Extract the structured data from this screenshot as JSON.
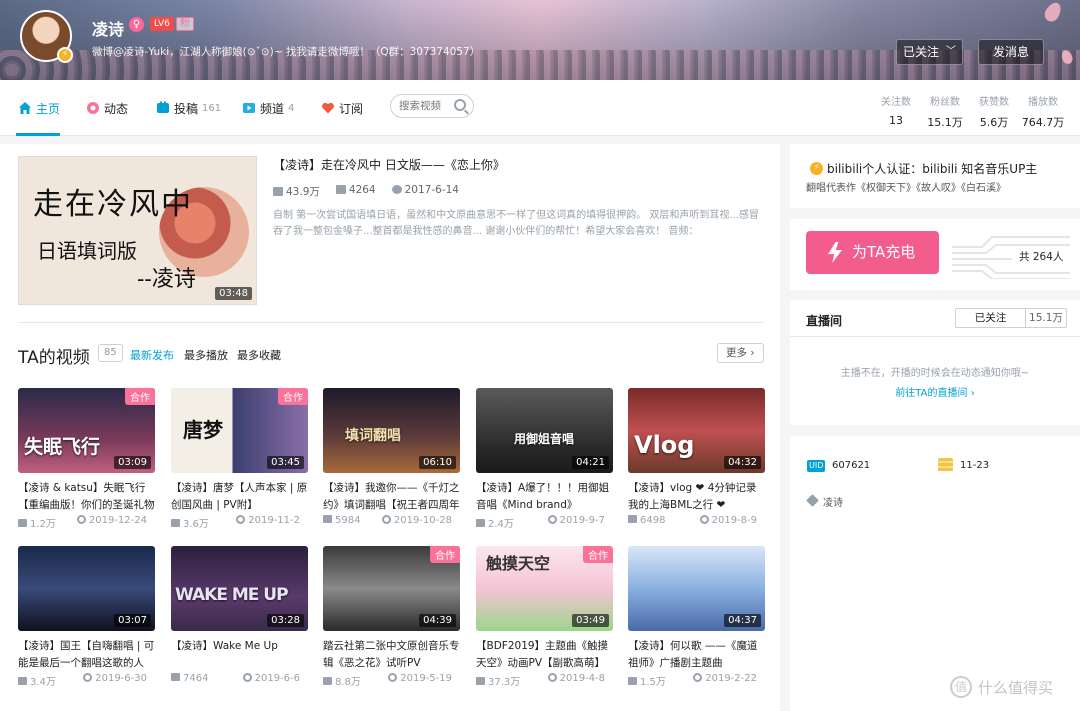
{
  "header": {
    "username": "凌诗",
    "gender_icon": "female-icon",
    "level": "LV6",
    "fan_badge": "粉",
    "sign": "微博@凌诗-Yuki，江湖人称御娘(⊙ˇ⊙)~ 找我请走微博哦！（Q群：307374057）",
    "followed_label": "已关注",
    "message_label": "发消息"
  },
  "nav": {
    "items": [
      {
        "label": "主页",
        "count": "",
        "icon": "home-icon"
      },
      {
        "label": "动态",
        "count": "",
        "icon": "dynamic-icon"
      },
      {
        "label": "投稿",
        "count": "161",
        "icon": "upload-icon"
      },
      {
        "label": "频道",
        "count": "4",
        "icon": "channel-icon"
      },
      {
        "label": "订阅",
        "count": "",
        "icon": "heart-icon"
      }
    ],
    "search_placeholder": "搜索视频",
    "stats": [
      {
        "label": "关注数",
        "value": "13"
      },
      {
        "label": "粉丝数",
        "value": "15.1万"
      },
      {
        "label": "获赞数",
        "value": "5.6万"
      },
      {
        "label": "播放数",
        "value": "764.7万"
      }
    ]
  },
  "featured": {
    "thumb_line1": "走在冷风中",
    "thumb_line2": "日语填词版",
    "thumb_line3": "--凌诗",
    "duration": "03:48",
    "title": "【凌诗】走在冷风中 日文版——《恋上你》",
    "plays": "43.9万",
    "danmaku": "4264",
    "date": "2017-6-14",
    "desc": "自制 第一次尝试国语填日语，虽然和中文原曲意思不一样了但这词真的填得很押韵。 双层和声听到耳视...感冒吞了我一整包金嗓子...整首都是我性感的鼻音... 谢谢小伙伴们的帮忙！希望大家会喜欢！ 音频："
  },
  "videos_section": {
    "title": "TA的视频",
    "count": "85",
    "sort_tabs": [
      "最新发布",
      "最多播放",
      "最多收藏"
    ],
    "more_label": "更多"
  },
  "videos": [
    {
      "thumb_text": "失眠飞行",
      "tag": "合作",
      "duration": "03:09",
      "title": "【凌诗 & katsu】失眠飞行【重编曲版！你们的圣诞礼物",
      "plays": "1.2万",
      "date": "2019-12-24"
    },
    {
      "thumb_text": "唐梦",
      "tag": "合作",
      "duration": "03:45",
      "title": "【凌诗】唐梦【人声本家 | 原创国风曲 | PV附】",
      "plays": "3.6万",
      "date": "2019-11-2"
    },
    {
      "thumb_text": "填词翻唱",
      "tag": "",
      "duration": "06:10",
      "title": "【凌诗】我邀你——《千灯之约》填词翻唱【祝王者四周年",
      "plays": "5984",
      "date": "2019-10-28"
    },
    {
      "thumb_text": "用御姐音唱",
      "tag": "",
      "duration": "04:21",
      "title": "【凌诗】A爆了！！！用御姐音唱《Mind brand》",
      "plays": "2.4万",
      "date": "2019-9-7"
    },
    {
      "thumb_text": "Vlog",
      "tag": "",
      "duration": "04:32",
      "title": "【凌诗】vlog ❤ 4分钟记录我的上海BML之行 ❤",
      "plays": "6498",
      "date": "2019-8-9"
    },
    {
      "thumb_text": "",
      "tag": "",
      "duration": "03:07",
      "title": "【凌诗】国王【自嗨翻唱 | 可能是最后一个翻唱这歌的人",
      "plays": "3.4万",
      "date": "2019-6-30"
    },
    {
      "thumb_text": "WAKE ME UP",
      "tag": "",
      "duration": "03:28",
      "title": "【凌诗】Wake Me Up",
      "plays": "7464",
      "date": "2019-6-6"
    },
    {
      "thumb_text": "",
      "tag": "合作",
      "duration": "04:39",
      "title": "踏云社第二张中文原创音乐专辑《恶之花》试听PV",
      "plays": "8.8万",
      "date": "2019-5-19"
    },
    {
      "thumb_text": "触摸天空",
      "tag": "合作",
      "duration": "03:49",
      "title": "【BDF2019】主题曲《触摸天空》动画PV【副歌高萌】",
      "plays": "37.3万",
      "date": "2019-4-8"
    },
    {
      "thumb_text": "",
      "tag": "",
      "duration": "04:37",
      "title": "【凌诗】何以歌 ——《魔道祖师》广播剧主题曲",
      "plays": "1.5万",
      "date": "2019-2-22"
    }
  ],
  "side": {
    "cert_line1": "bilibili个人认证：bilibili 知名音乐UP主",
    "cert_line2": "翻唱代表作《权御天下》《故人叹》《白石溪》",
    "charge_label": "为TA充电",
    "charge_count": "共 264人",
    "live_title": "直播间",
    "live_follow": "已关注",
    "live_fans": "15.1万",
    "live_tip": "主播不在，开播的时候会在动态通知你哦~",
    "live_go": "前往TA的直播间",
    "uid_label": "UID",
    "uid": "607621",
    "birthday": "11-23",
    "tag": "凌诗"
  },
  "watermark": {
    "icon": "值",
    "text": "什么值得买"
  }
}
